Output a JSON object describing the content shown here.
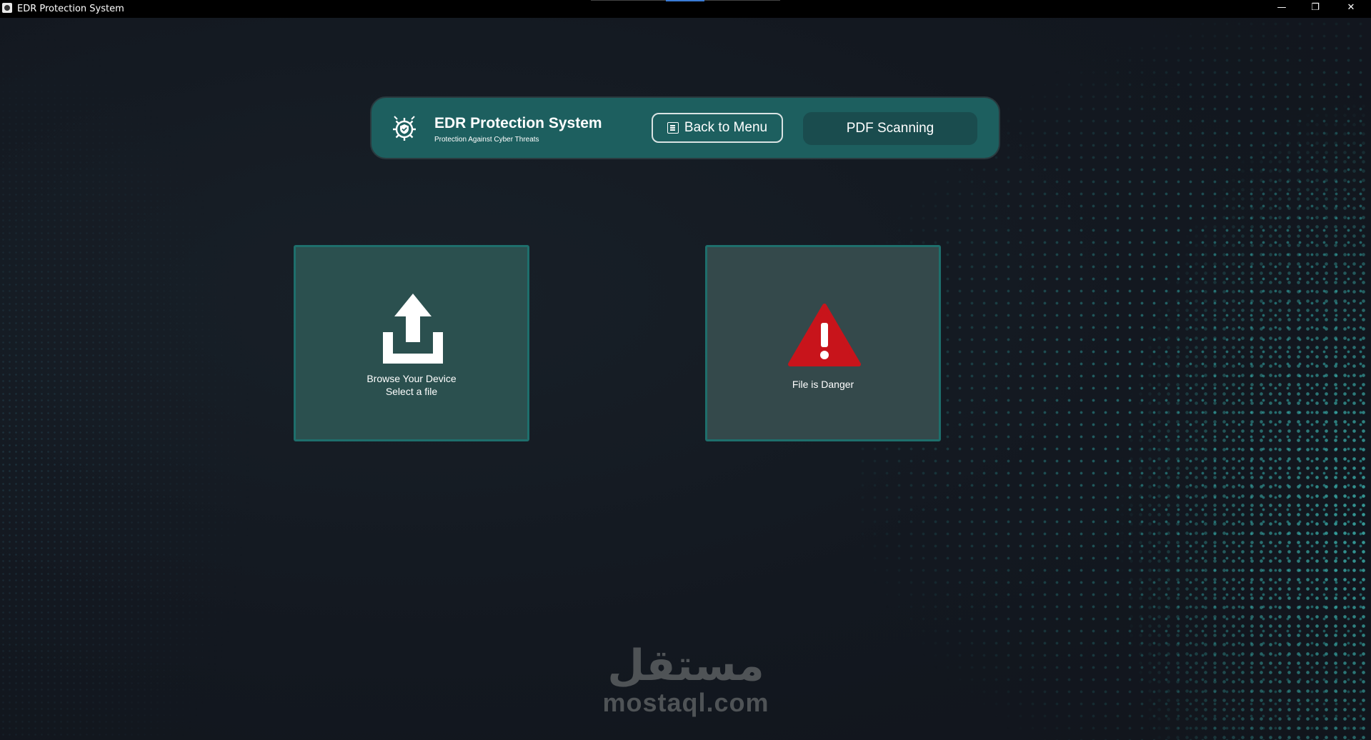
{
  "window": {
    "title": "EDR Protection System",
    "controls": {
      "minimize": "—",
      "maximize": "❐",
      "close": "✕"
    }
  },
  "header": {
    "logo_icon": "shield-gear-icon",
    "title": "EDR Protection System",
    "subtitle": "Protection Against Cyber Threats",
    "back_label": "Back to Menu",
    "back_icon": "back-list-icon",
    "pdf_label": "PDF Scanning"
  },
  "browse_card": {
    "icon": "upload-icon",
    "line1": "Browse Your Device",
    "line2": "Select a file"
  },
  "result_card": {
    "icon": "warning-icon",
    "status": "File is Danger",
    "status_color": "#c8141b"
  },
  "watermark": {
    "arabic": "مستقل",
    "latin": "mostaql.com"
  },
  "colors": {
    "header_bg": "#1d5f5f",
    "card_border": "#1e6f6c",
    "dots": "#2d9696"
  }
}
